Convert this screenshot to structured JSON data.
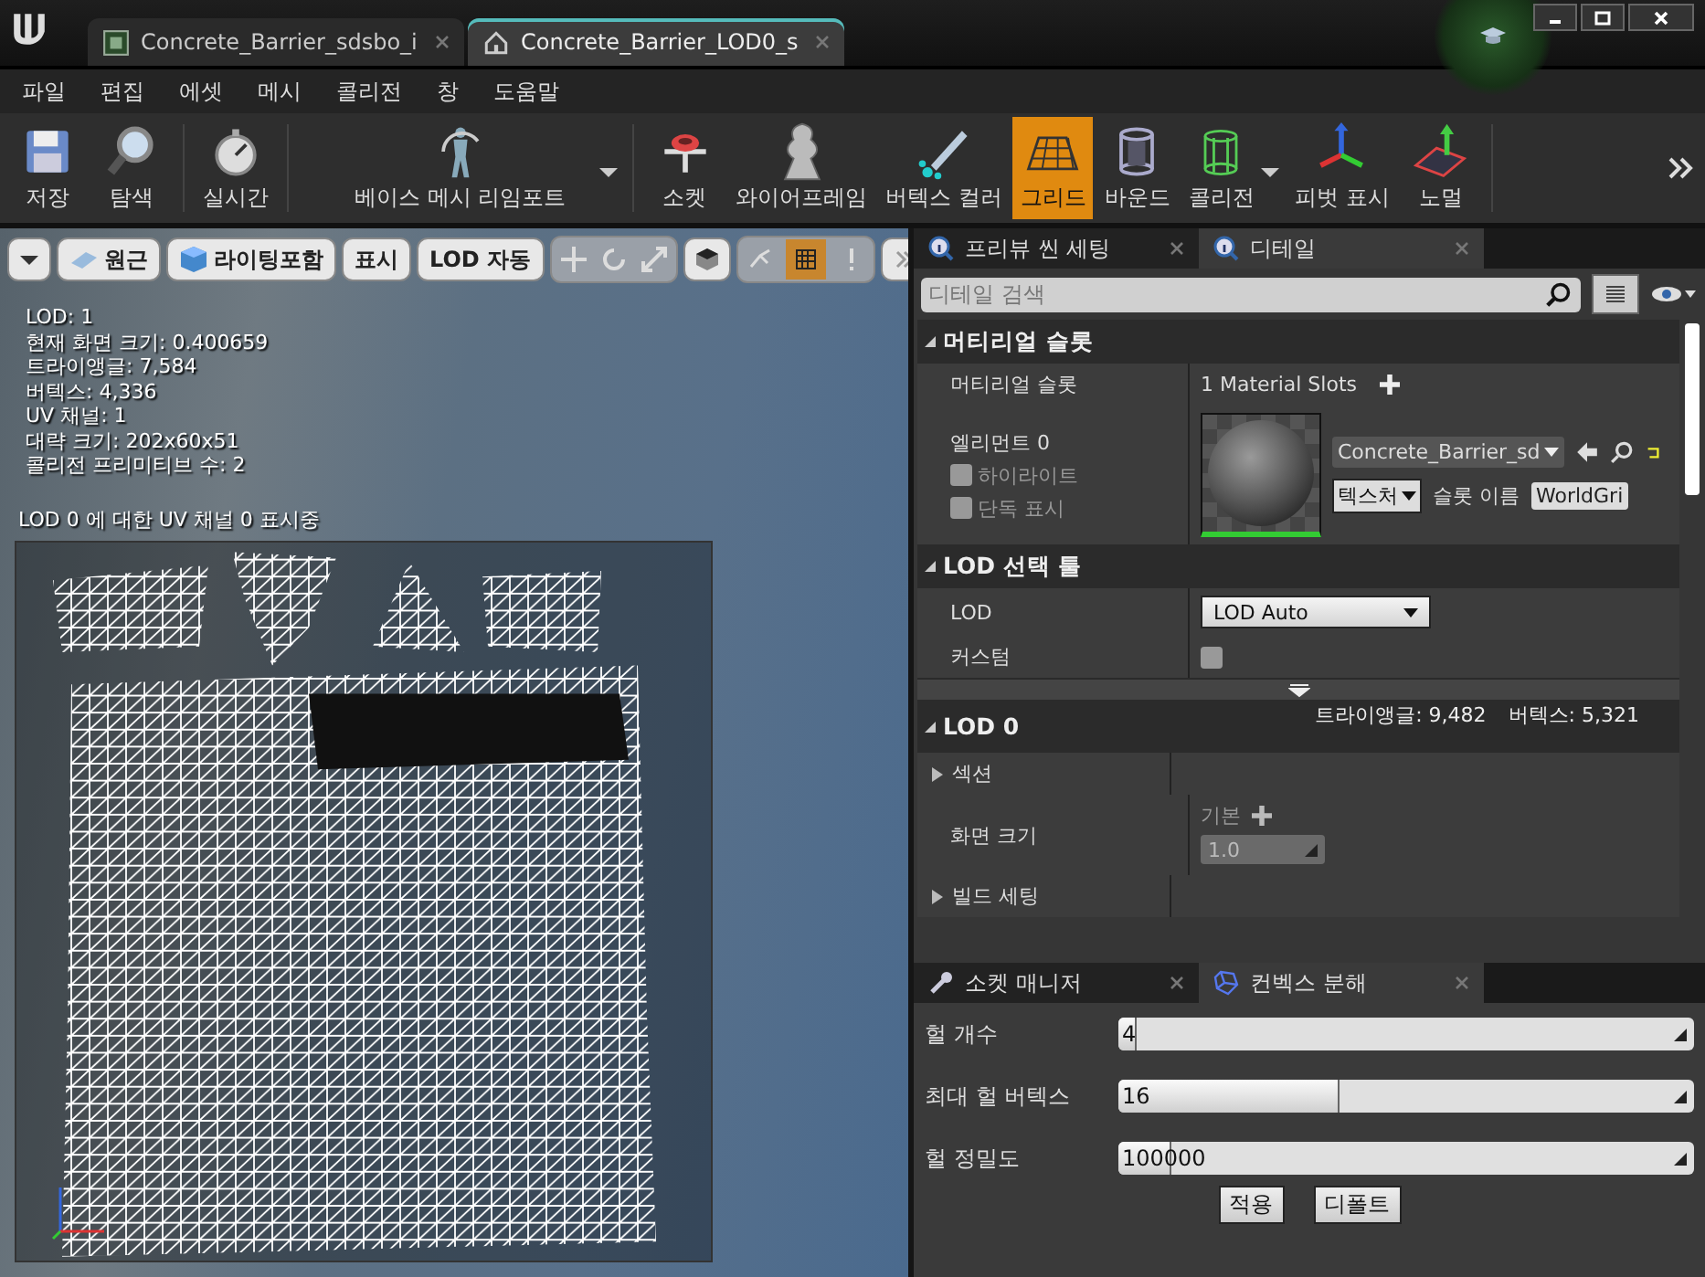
{
  "title_bar": {
    "tabs": [
      {
        "label": "Concrete_Barrier_sdsbo_i",
        "kind": "texture",
        "selected": false
      },
      {
        "label": "Concrete_Barrier_LOD0_s",
        "kind": "mesh",
        "selected": true
      }
    ]
  },
  "menu": [
    "파일",
    "편집",
    "에셋",
    "메시",
    "콜리전",
    "창",
    "도움말"
  ],
  "toolbar": [
    [
      {
        "label": "저장",
        "kind": "save",
        "selected": false,
        "dropdown": false
      },
      {
        "label": "탐색",
        "kind": "browse",
        "selected": false,
        "dropdown": false
      }
    ],
    [
      {
        "label": "실시간",
        "kind": "stopwatch",
        "selected": false,
        "dropdown": false
      }
    ],
    [
      {
        "label": "베이스 메시 리임포트",
        "kind": "figure",
        "selected": false,
        "dropdown": true
      }
    ],
    [
      {
        "label": "소켓",
        "kind": "socket",
        "selected": false,
        "dropdown": false
      },
      {
        "label": "와이어프레임",
        "kind": "wire",
        "selected": false,
        "dropdown": false
      },
      {
        "label": "버텍스 컬러",
        "kind": "brush",
        "selected": false,
        "dropdown": false
      },
      {
        "label": "그리드",
        "kind": "grid",
        "selected": true,
        "dropdown": false
      },
      {
        "label": "바운드",
        "kind": "bounds",
        "selected": false,
        "dropdown": false
      },
      {
        "label": "콜리전",
        "kind": "collision",
        "selected": false,
        "dropdown": true
      },
      {
        "label": "피벗 표시",
        "kind": "pivot",
        "selected": false,
        "dropdown": false
      },
      {
        "label": "노멀",
        "kind": "normal",
        "selected": false,
        "dropdown": false
      }
    ]
  ],
  "viewport": {
    "buttons": [
      {
        "label": "원근",
        "kind": "perspective"
      },
      {
        "label": "라이팅포함",
        "kind": "lit"
      },
      {
        "label": "표시",
        "kind": "plain"
      },
      {
        "label": "LOD 자동",
        "kind": "plain"
      }
    ],
    "grid_snap": {
      "selected": true
    },
    "stats": [
      "LOD:  1",
      "현재 화면 크기: 0.400659",
      "트라이앵글: 7,584",
      "버텍스: 4,336",
      "UV 채널:  1",
      "대략 크기: 202x60x51",
      "콜리전 프리미티브 수: 2"
    ],
    "uv_caption": "LOD 0 에 대한 UV 채널 0 표시중"
  },
  "details": {
    "tabs": [
      {
        "label": "프리뷰 씬 세팅",
        "selected": false
      },
      {
        "label": "디테일",
        "selected": true
      }
    ],
    "search": {
      "placeholder": "디테일 검색"
    },
    "material_slots": {
      "header": "머티리얼 슬롯",
      "label": "머티리얼 슬롯",
      "count": "1 Material Slots",
      "element": "엘리먼트 0",
      "checkboxes": [
        {
          "label": "하이라이트",
          "checked": false
        },
        {
          "label": "단독 표시",
          "checked": false
        }
      ],
      "material": "Concrete_Barrier_sd",
      "texture_button": "텍스처",
      "slot_name_label": "슬롯 이름",
      "slot_name": "WorldGri"
    },
    "lod_picker": {
      "header": "LOD 선택 툴",
      "lod_label": "LOD",
      "lod_value": "LOD Auto",
      "custom_label": "커스텀",
      "custom_checked": false
    },
    "lod0": {
      "header": "LOD 0",
      "triangles": "트라이앵글: 9,482",
      "vertices": "버텍스: 5,321",
      "sections": "섹션",
      "screen_size": "화면 크기",
      "default_label": "기본",
      "screen_size_value": "1.0",
      "build_settings": "빌드 세팅"
    }
  },
  "convex": {
    "tabs": [
      {
        "label": "소켓 매니저",
        "kind": "socket",
        "selected": false
      },
      {
        "label": "컨벡스 분해",
        "kind": "hull",
        "selected": true
      }
    ],
    "sliders": [
      {
        "label": "헐 개수",
        "value": "4",
        "level": 0.03
      },
      {
        "label": "최대 헐 버텍스",
        "value": "16",
        "level": 0.38
      },
      {
        "label": "헐 정밀도",
        "value": "100000",
        "level": 0.09
      }
    ],
    "buttons": [
      "적용",
      "디폴트"
    ]
  }
}
